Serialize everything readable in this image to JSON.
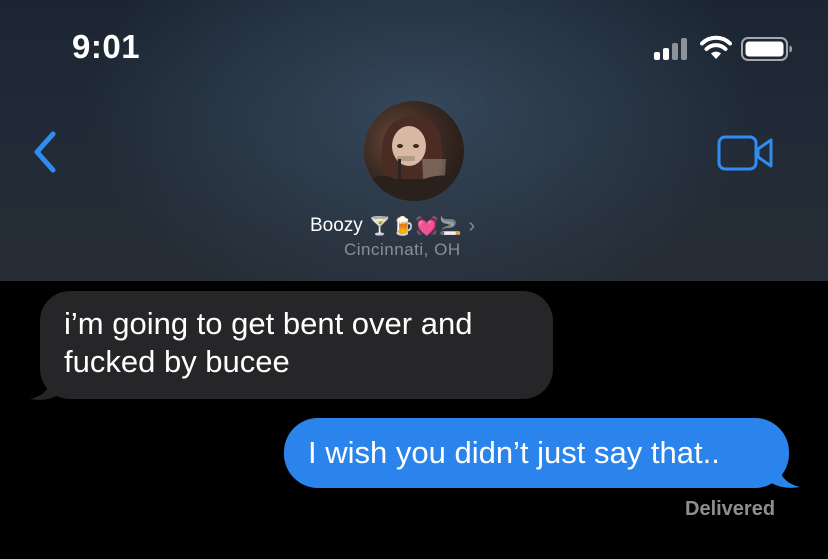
{
  "status_bar": {
    "time": "9:01",
    "signal_icon": "cellular-signal-icon",
    "wifi_icon": "wifi-icon",
    "battery_icon": "battery-icon"
  },
  "nav": {
    "back_icon": "chevron-left-icon",
    "video_icon": "video-call-icon",
    "accent_color": "#2f8df0"
  },
  "contact": {
    "name": "Boozy",
    "emoji_suffix": "🍸🍺💓🚬",
    "location": "Cincinnati, OH",
    "avatar": "contact-avatar-photo"
  },
  "messages": [
    {
      "direction": "incoming",
      "text_lines": [
        "i’m going to get bent over and",
        "fucked by bucee"
      ],
      "bubble_color": "#262628"
    },
    {
      "direction": "outgoing",
      "text": "I wish you didn’t just say that..",
      "bubble_color": "#2b84ec"
    }
  ],
  "receipt": "Delivered"
}
